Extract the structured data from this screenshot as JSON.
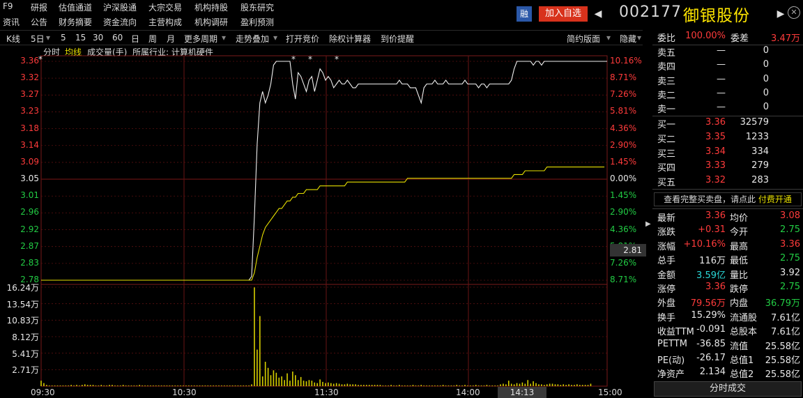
{
  "menu": {
    "row1": [
      "F9",
      "研报",
      "估值通道",
      "沪深股通",
      "大宗交易",
      "机构持股",
      "股东研究"
    ],
    "row2": [
      "资讯",
      "公告",
      "财务摘要",
      "资金流向",
      "主营构成",
      "机构调研",
      "盈利预测"
    ]
  },
  "header": {
    "rong_label": "融",
    "add_fav_label": "加入自选",
    "prev_arrow": "◀",
    "next_arrow": "▶",
    "code": "002177",
    "name": "御银股份",
    "close_icon": "✕"
  },
  "toolbar": {
    "items": [
      "K线",
      "5日",
      "5",
      "15",
      "30",
      "60",
      "日",
      "周",
      "月",
      "更多周期",
      "走势叠加",
      "打开竞价",
      "除权计算器",
      "到价提醒"
    ],
    "layout_label": "简约版面",
    "hide_label": "隐藏"
  },
  "subbar": {
    "fenshi": "分时",
    "junxian": "均线",
    "volume": "成交量(手)",
    "industry": "所属行业: 计算机硬件"
  },
  "price_axis": {
    "left_labels": [
      "3.36",
      "3.32",
      "3.27",
      "3.23",
      "3.18",
      "3.14",
      "3.09",
      "3.05",
      "3.01",
      "2.96",
      "2.92",
      "2.87",
      "2.83",
      "2.78"
    ],
    "right_labels": [
      "10.16%",
      "8.71%",
      "7.26%",
      "5.81%",
      "4.36%",
      "2.90%",
      "1.45%",
      "0.00%",
      "1.45%",
      "2.90%",
      "4.36%",
      "5.81%",
      "7.26%",
      "8.71%"
    ],
    "crosshair_price": "2.81"
  },
  "volume_axis": {
    "labels": [
      "16.24万",
      "13.54万",
      "10.83万",
      "8.12万",
      "5.41万",
      "2.71万"
    ]
  },
  "time_axis": {
    "labels": [
      "09:30",
      "10:30",
      "11:30",
      "14:00",
      "15:00"
    ],
    "crosshair_time": "14:13"
  },
  "colors": {
    "price_line": "#f0f0f0",
    "avg_line": "#e8e000",
    "volume_bar": "#d8d000",
    "up": "#ff3b3b",
    "down": "#22cc44",
    "grid": "#8b1a1a"
  },
  "chart_data": {
    "type": "line",
    "ylim": [
      2.78,
      3.36
    ],
    "prev_close": 3.05,
    "series": [
      {
        "values": [
          2.78,
          2.78,
          2.78,
          2.78,
          2.78,
          2.78,
          2.78,
          2.78,
          2.78,
          2.78,
          2.78,
          2.78,
          2.78,
          2.78,
          2.78,
          2.78,
          2.78,
          2.78,
          2.78,
          2.78,
          2.78,
          2.78,
          2.78,
          2.78,
          2.78,
          2.78,
          2.78,
          2.78,
          2.78,
          2.78,
          2.78,
          2.78,
          2.78,
          2.78,
          2.78,
          2.78,
          2.78,
          2.78,
          2.78,
          2.78,
          2.78,
          2.78,
          2.78,
          2.78,
          2.78,
          2.78,
          2.78,
          2.78,
          2.78,
          2.78,
          2.78,
          2.78,
          2.78,
          2.78,
          2.78,
          2.78,
          2.78,
          2.78,
          2.78,
          2.78,
          2.78,
          2.78,
          2.78,
          2.78,
          2.78,
          2.78,
          2.78,
          2.78,
          2.78,
          2.78,
          2.78,
          2.78,
          2.78,
          2.78,
          2.78,
          2.78,
          2.78,
          2.79,
          2.95,
          3.14,
          3.25,
          3.28,
          3.25,
          3.27,
          3.3,
          3.35,
          3.36,
          3.36,
          3.36,
          3.36,
          3.36,
          3.36,
          3.3,
          3.26,
          3.33,
          3.32,
          3.3,
          3.28,
          3.31,
          3.32,
          3.28,
          3.31,
          3.34,
          3.33,
          3.31,
          3.32,
          3.31,
          3.29,
          3.3,
          3.31,
          3.3,
          3.3,
          3.31,
          3.3,
          3.29,
          3.29,
          3.3,
          3.3,
          3.3,
          3.3,
          3.3,
          3.3,
          3.3,
          3.3,
          3.3,
          3.3,
          3.3,
          3.3,
          3.3,
          3.3,
          3.3,
          3.31,
          3.3,
          3.3,
          3.3,
          3.29,
          3.29,
          3.29,
          3.27,
          3.25,
          3.29,
          3.3,
          3.3,
          3.3,
          3.31,
          3.3,
          3.3,
          3.3,
          3.31,
          3.3,
          3.3,
          3.3,
          3.3,
          3.3,
          3.3,
          3.31,
          3.3,
          3.3,
          3.3,
          3.3,
          3.29,
          3.3,
          3.3,
          3.29,
          3.3,
          3.3,
          3.3,
          3.3,
          3.3,
          3.3,
          3.3,
          3.3,
          3.31,
          3.34,
          3.36,
          3.36,
          3.36,
          3.36,
          3.36,
          3.36,
          3.35,
          3.36,
          3.36,
          3.35,
          3.36,
          3.36,
          3.36,
          3.36,
          3.36,
          3.36,
          3.36,
          3.36,
          3.36,
          3.36,
          3.36,
          3.36,
          3.36,
          3.36,
          3.36,
          3.36,
          3.36,
          3.36,
          3.36,
          3.36,
          3.36,
          3.36,
          3.36,
          3.36
        ]
      },
      {
        "values": [
          2.78,
          2.78,
          2.78,
          2.78,
          2.78,
          2.78,
          2.78,
          2.78,
          2.78,
          2.78,
          2.78,
          2.78,
          2.78,
          2.78,
          2.78,
          2.78,
          2.78,
          2.78,
          2.78,
          2.78,
          2.78,
          2.78,
          2.78,
          2.78,
          2.78,
          2.78,
          2.78,
          2.78,
          2.78,
          2.78,
          2.78,
          2.78,
          2.78,
          2.78,
          2.78,
          2.78,
          2.78,
          2.78,
          2.78,
          2.78,
          2.78,
          2.78,
          2.78,
          2.78,
          2.78,
          2.78,
          2.78,
          2.78,
          2.78,
          2.78,
          2.78,
          2.78,
          2.78,
          2.78,
          2.78,
          2.78,
          2.78,
          2.78,
          2.78,
          2.78,
          2.78,
          2.78,
          2.78,
          2.78,
          2.78,
          2.78,
          2.78,
          2.78,
          2.78,
          2.78,
          2.78,
          2.78,
          2.78,
          2.78,
          2.78,
          2.78,
          2.78,
          2.78,
          2.8,
          2.84,
          2.87,
          2.9,
          2.92,
          2.93,
          2.94,
          2.95,
          2.96,
          2.97,
          2.97,
          2.98,
          2.99,
          2.99,
          3.0,
          3.0,
          3.01,
          3.01,
          3.01,
          3.02,
          3.02,
          3.02,
          3.02,
          3.02,
          3.03,
          3.03,
          3.03,
          3.03,
          3.03,
          3.03,
          3.03,
          3.03,
          3.03,
          3.03,
          3.04,
          3.04,
          3.04,
          3.04,
          3.04,
          3.04,
          3.04,
          3.04,
          3.04,
          3.04,
          3.04,
          3.04,
          3.04,
          3.04,
          3.04,
          3.04,
          3.04,
          3.04,
          3.04,
          3.04,
          3.04,
          3.04,
          3.05,
          3.05,
          3.05,
          3.05,
          3.05,
          3.05,
          3.05,
          3.05,
          3.05,
          3.05,
          3.05,
          3.05,
          3.05,
          3.05,
          3.05,
          3.05,
          3.05,
          3.05,
          3.05,
          3.05,
          3.05,
          3.05,
          3.05,
          3.05,
          3.05,
          3.05,
          3.05,
          3.05,
          3.05,
          3.05,
          3.05,
          3.05,
          3.05,
          3.05,
          3.05,
          3.05,
          3.05,
          3.05,
          3.05,
          3.06,
          3.06,
          3.06,
          3.06,
          3.07,
          3.07,
          3.07,
          3.07,
          3.07,
          3.07,
          3.07,
          3.07,
          3.08,
          3.08,
          3.08,
          3.08,
          3.08,
          3.08,
          3.08,
          3.08,
          3.08,
          3.08,
          3.08,
          3.08,
          3.08,
          3.08,
          3.08,
          3.08,
          3.08,
          3.08,
          3.08,
          3.08,
          3.08,
          3.08
        ]
      }
    ],
    "volume": {
      "ylim": [
        0,
        16.24
      ],
      "values": [
        0.9,
        0.5,
        0.2,
        0.1,
        0.1,
        0.1,
        0.1,
        0.1,
        0.1,
        0.1,
        0.1,
        0.2,
        0.1,
        0.2,
        0.1,
        0.2,
        0.3,
        0.2,
        0.2,
        0.2,
        0.1,
        0.1,
        0.2,
        0.1,
        0.1,
        0.2,
        0.2,
        0.1,
        0.1,
        0.1,
        0.2,
        0.1,
        0.1,
        0.1,
        0.1,
        0.1,
        0.2,
        0.1,
        0.1,
        0.1,
        0.1,
        0.1,
        0.1,
        0.1,
        0.1,
        0.1,
        0.1,
        0.1,
        0.1,
        0.1,
        0.1,
        0.1,
        0.1,
        0.1,
        0.1,
        0.1,
        0.1,
        0.1,
        0.1,
        0.1,
        0.1,
        0.1,
        0.1,
        0.1,
        0.1,
        0.1,
        0.1,
        0.1,
        0.1,
        0.1,
        0.1,
        0.1,
        0.1,
        0.1,
        0.1,
        0.1,
        0.1,
        0.3,
        16.2,
        6.0,
        11.5,
        1.6,
        4.0,
        3.0,
        1.8,
        2.6,
        2.2,
        1.4,
        1.6,
        1.0,
        2.1,
        0.9,
        2.4,
        1.8,
        1.0,
        1.5,
        0.9,
        0.8,
        1.0,
        0.9,
        0.6,
        0.5,
        1.1,
        0.7,
        0.5,
        0.6,
        0.5,
        0.4,
        0.5,
        0.4,
        0.3,
        0.3,
        0.4,
        0.3,
        0.3,
        0.3,
        0.2,
        0.2,
        0.2,
        0.2,
        0.2,
        0.2,
        0.2,
        0.2,
        0.2,
        0.1,
        0.1,
        0.1,
        0.2,
        0.1,
        0.1,
        0.2,
        0.1,
        0.1,
        0.1,
        0.1,
        0.2,
        0.1,
        0.1,
        0.2,
        0.1,
        0.1,
        0.1,
        0.1,
        0.1,
        0.1,
        0.1,
        0.2,
        0.1,
        0.1,
        0.1,
        0.1,
        0.2,
        0.1,
        0.1,
        0.2,
        0.1,
        0.1,
        0.1,
        0.2,
        0.1,
        0.1,
        0.1,
        0.2,
        0.1,
        0.1,
        0.1,
        0.1,
        0.3,
        0.4,
        0.3,
        0.9,
        0.4,
        0.3,
        0.5,
        0.4,
        0.6,
        0.4,
        1.0,
        0.4,
        0.8,
        0.5,
        0.3,
        0.3,
        0.2,
        0.3,
        0.4,
        0.4,
        0.3,
        0.3,
        0.2,
        0.3,
        0.2,
        0.3,
        0.2,
        0.2,
        0.3,
        0.2,
        0.2,
        0.2,
        0.2,
        0.4
      ]
    }
  },
  "panel": {
    "weibi_label": "委比",
    "weibi_value": "100.00%",
    "weicha_label": "委差",
    "weicha_value": "3.47万",
    "sell": [
      {
        "label": "卖五",
        "price": "—",
        "vol": "0"
      },
      {
        "label": "卖四",
        "price": "—",
        "vol": "0"
      },
      {
        "label": "卖三",
        "price": "—",
        "vol": "0"
      },
      {
        "label": "卖二",
        "price": "—",
        "vol": "0"
      },
      {
        "label": "卖一",
        "price": "—",
        "vol": "0"
      }
    ],
    "buy": [
      {
        "label": "买一",
        "price": "3.36",
        "vol": "32579"
      },
      {
        "label": "买二",
        "price": "3.35",
        "vol": "1233"
      },
      {
        "label": "买三",
        "price": "3.34",
        "vol": "334"
      },
      {
        "label": "买四",
        "price": "3.33",
        "vol": "279"
      },
      {
        "label": "买五",
        "price": "3.32",
        "vol": "283"
      }
    ],
    "notice_text": "查看完整买卖盘，请点此",
    "notice_link": "付费开通",
    "stats": [
      {
        "l1": "最新",
        "v1": "3.36",
        "c1": "red",
        "l2": "均价",
        "v2": "3.08",
        "c2": "red"
      },
      {
        "l1": "涨跌",
        "v1": "+0.31",
        "c1": "red",
        "l2": "今开",
        "v2": "2.75",
        "c2": "green"
      },
      {
        "l1": "涨幅",
        "v1": "+10.16%",
        "c1": "red",
        "l2": "最高",
        "v2": "3.36",
        "c2": "red"
      },
      {
        "l1": "总手",
        "v1": "116万",
        "c1": "white",
        "l2": "最低",
        "v2": "2.75",
        "c2": "green"
      },
      {
        "l1": "金额",
        "v1": "3.59亿",
        "c1": "cyan",
        "l2": "量比",
        "v2": "3.92",
        "c2": "white"
      },
      {
        "l1": "涨停",
        "v1": "3.36",
        "c1": "red",
        "l2": "跌停",
        "v2": "2.75",
        "c2": "green"
      },
      {
        "l1": "外盘",
        "v1": "79.56万",
        "c1": "red",
        "l2": "内盘",
        "v2": "36.79万",
        "c2": "green"
      },
      {
        "l1": "换手",
        "v1": "15.29%",
        "c1": "white",
        "l2": "流通股",
        "v2": "7.61亿",
        "c2": "white"
      },
      {
        "l1": "收益TTM",
        "v1": "-0.091",
        "c1": "white",
        "l2": "总股本",
        "v2": "7.61亿",
        "c2": "white"
      },
      {
        "l1": "PETTM",
        "v1": "-36.85",
        "c1": "white",
        "l2": "流值",
        "v2": "25.58亿",
        "c2": "white"
      },
      {
        "l1": "PE(动)",
        "v1": "-26.17",
        "c1": "white",
        "l2": "总值1",
        "v2": "25.58亿",
        "c2": "white"
      },
      {
        "l1": "净资产",
        "v1": "2.134",
        "c1": "white",
        "l2": "总值2",
        "v2": "25.58亿",
        "c2": "white"
      }
    ],
    "bottom_button": "分时成交"
  }
}
